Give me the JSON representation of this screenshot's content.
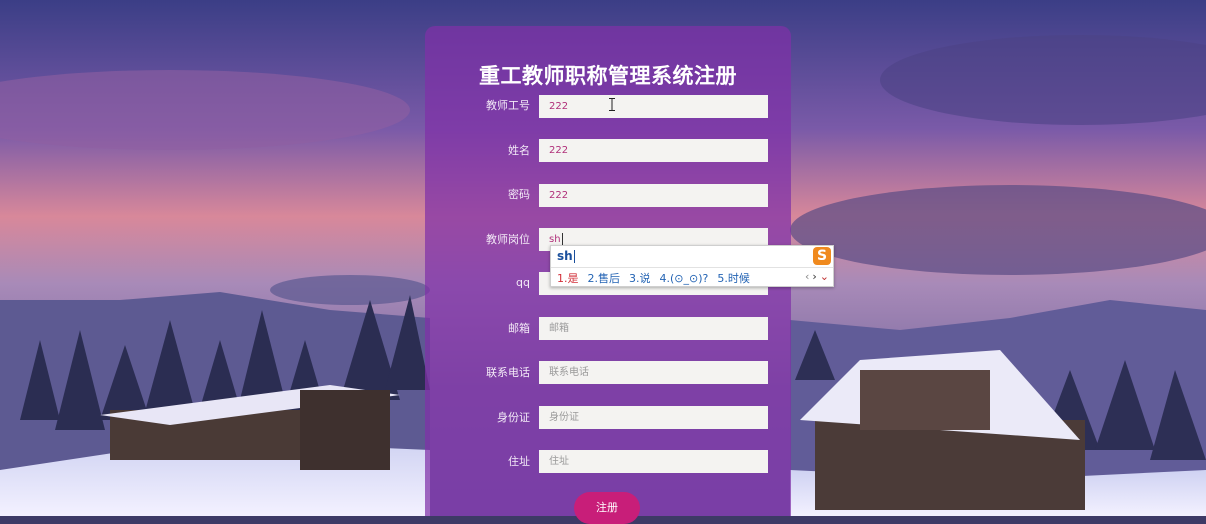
{
  "form": {
    "title": "重工教师职称管理系统注册",
    "fields": [
      {
        "label": "教师工号",
        "value": "222",
        "placeholder": ""
      },
      {
        "label": "姓名",
        "value": "222",
        "placeholder": ""
      },
      {
        "label": "密码",
        "value": "222",
        "placeholder": ""
      },
      {
        "label": "教师岗位",
        "value": "sh",
        "placeholder": ""
      },
      {
        "label": "qq",
        "value": "",
        "placeholder": ""
      },
      {
        "label": "邮箱",
        "value": "",
        "placeholder": "邮箱"
      },
      {
        "label": "联系电话",
        "value": "",
        "placeholder": "联系电话"
      },
      {
        "label": "身份证",
        "value": "",
        "placeholder": "身份证"
      },
      {
        "label": "住址",
        "value": "",
        "placeholder": "住址"
      }
    ],
    "submit_label": "注册"
  },
  "ime": {
    "composition": "sh",
    "logo": "S",
    "candidates": [
      "1.是",
      "2.售后",
      "3.说",
      "4.(⊙_⊙)?",
      "5.时候"
    ],
    "nav": [
      "‹",
      "›",
      "⌄"
    ]
  },
  "colors": {
    "panel": "#8030a8",
    "submit": "#c81e79",
    "field_bg": "#f4f3f1",
    "value_text": "#b0307a"
  }
}
